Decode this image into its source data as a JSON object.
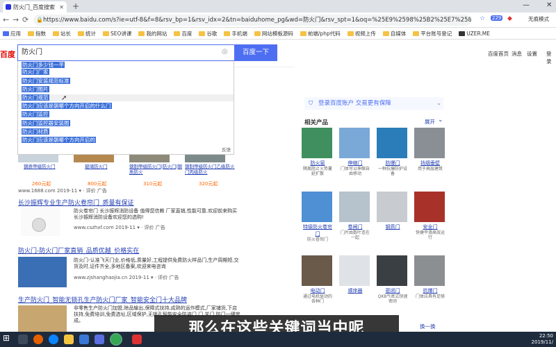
{
  "browser": {
    "tab_title": "防火门_百度搜索",
    "address": "https://www.baidu.com/s?ie=utf-8&f=8&rsv_bp=1&rsv_idx=2&tn=baiduhome_pg&wd=防火门&rsv_spt=1&oq=%25E9%2598%25B2%25E7%2581%25AB%25...",
    "ext_badge": "229",
    "ext_label": "无痕模式",
    "bookmarks": [
      "应用",
      "指数",
      "站长",
      "统计",
      "SEO讲课",
      "我的网站",
      "百度",
      "谷歌",
      "手机端",
      "网站模板源码",
      "前端/php代码",
      "视频上传",
      "自媒体",
      "平台账号登记",
      "UZER.ME"
    ]
  },
  "baidu": {
    "logo": "百度",
    "query": "防火门",
    "search_btn": "百度一下",
    "top_links": [
      "百度首页",
      "消息",
      "设置",
      "登录"
    ],
    "prefix": "防火门",
    "suggestions": [
      "多少钱一平",
      "厂家",
      "安装规范标准",
      "图片",
      "规范",
      "应该是朝哪个方向开启的什么门",
      "监控",
      "监控器安装图",
      "材质",
      "应该是朝哪个方向开启的"
    ],
    "feedback": "反馈"
  },
  "results": {
    "img_captions": [
      "钢质甲级防火门",
      "玻璃防火门",
      "钢制甲级防火门|防火门|钢质防火",
      "钢制甲级防火门乙级防火门丙级防火",
      "320元起"
    ],
    "prices": [
      "260元起",
      "800元起",
      "310元起",
      "320元起"
    ],
    "r1_url": "www.1688.com  2019-11 ▾ · 评价 广告",
    "r2_title": "长沙振辉专业生产防火卷帘门_质量有保证",
    "r2_snip": "防火卷帘门 长沙振辉消防设备 值得您信赖 厂家直销,性能可靠.欢迎前来购买长沙振辉消防设备欢迎您的选购!",
    "r2_url": "www.cszhxf.com  2019-11 ▾ · 评价 广告",
    "r3_title": "防火门-防火门厂家直销_品质优越_价格实在",
    "r3_snip": "防火门-认准飞天门业,价格低,质量好,工程提供免费防火样品门,生产周期短,交货及时,证件齐全,多地区备案,欢迎来电咨询",
    "r3_url": "www.zjshanghaojia.cn  2019-11 ▾ · 评价 广告",
    "r4_title": "生产防火门_智能无锁孔生产防火门厂家_智能安全门十大品牌",
    "r4_snip": "非零售生产防火门加盟,除品输出,保障式扶持,成熟的运作模式,厂家铺货,下店扶持,免费培训,免费选址,区域保护,无锁孔智能安全防盗门,门,关门,防门一键完成。"
  },
  "right_panel": {
    "banner": "登录百度账户  交易更有保障",
    "section": "相关产品",
    "expand": "展开",
    "products": [
      {
        "name": "防火窗",
        "desc": "隔离阻止火势蔓延扩散",
        "color": "#3f8f5f"
      },
      {
        "name": "伸缩门",
        "desc": "门体可以伸缩自由移动",
        "color": "#7aa9d8"
      },
      {
        "name": "防爆门",
        "desc": "一种抗爆防护设备",
        "color": "#2a7db8"
      },
      {
        "name": "挡烟垂壁",
        "desc": "用于高层建筑",
        "color": "#8a8f96"
      },
      {
        "name": "特级防火卷帘门",
        "desc": "防火卷帘门",
        "color": "#4f8fd4"
      },
      {
        "name": "卷闸门",
        "desc": "门片由数叶连在一起",
        "color": "#b6c2cc"
      },
      {
        "name": "钢质门",
        "desc": "",
        "color": "#c8ccd0"
      },
      {
        "name": "安全门",
        "desc": "快捷平滑高效运行",
        "color": "#a8322a"
      },
      {
        "name": "电动门",
        "desc": "通过电机驱动的各种门",
        "color": "#6a5a4a"
      },
      {
        "name": "顺序器",
        "desc": "",
        "color": "#dfe2e6"
      },
      {
        "name": "密闭门",
        "desc": "QKB气密式快速密闭",
        "color": "#3a3f44"
      },
      {
        "name": "抗爆门",
        "desc": "门体应具有足够",
        "color": "#8c8f92"
      }
    ],
    "switch": "换一换"
  },
  "taskbar": {
    "time": "22:50",
    "date": "2019/11/"
  },
  "subtitle": "那么在这些关键词当中呢"
}
